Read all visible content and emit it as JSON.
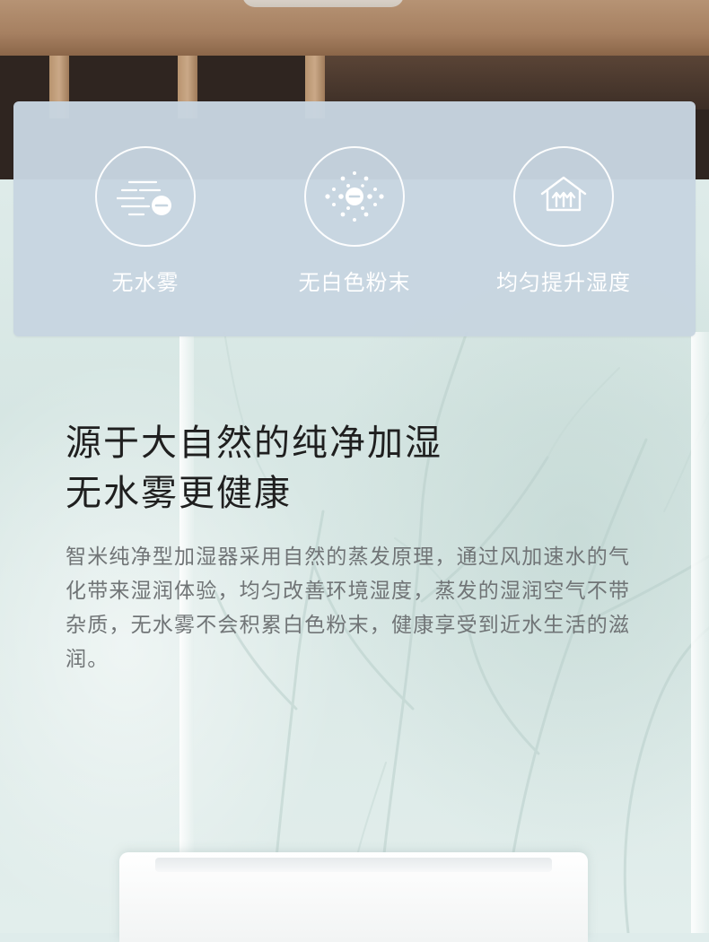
{
  "features": [
    {
      "icon": "no-mist-icon",
      "label": "无水雾"
    },
    {
      "icon": "no-white-powder-icon",
      "label": "无白色粉末"
    },
    {
      "icon": "even-humidity-icon",
      "label": "均匀提升湿度"
    }
  ],
  "headline": {
    "line1": "源于大自然的纯净加湿",
    "line2": "无水雾更健康"
  },
  "description": "智米纯净型加湿器采用自然的蒸发原理，通过风加速水的气化带来湿润体验，均匀改善环境湿度，蒸发的湿润空气不带杂质，无水雾不会积累白色粉末，健康享受到近水生活的滋润。",
  "colors": {
    "panel": "#c7d5e0",
    "headline": "#1f1f1f",
    "body": "#707476"
  }
}
